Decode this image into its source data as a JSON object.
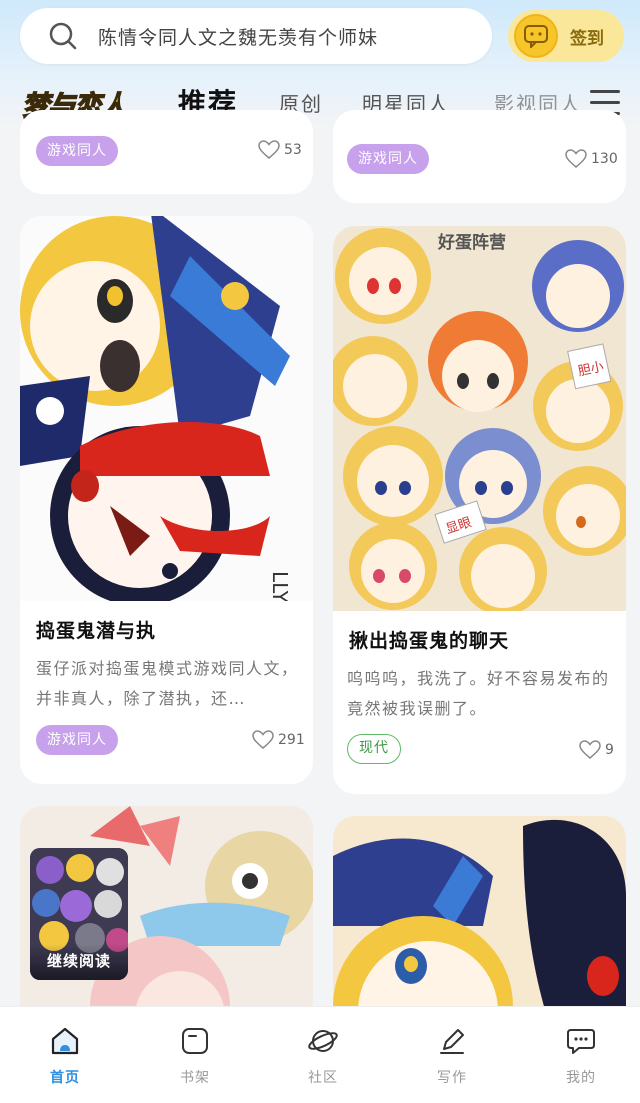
{
  "search": {
    "text": "陈情令同人文之魏无羡有个师妹"
  },
  "signin": {
    "label": "签到"
  },
  "header": {
    "logo": "梦与恋人",
    "tabs": [
      "推荐",
      "原创",
      "明星同人",
      "影视同人"
    ]
  },
  "cards": {
    "top_left": {
      "tag": "游戏同人",
      "likes": "53"
    },
    "top_right": {
      "tag": "游戏同人",
      "likes": "130"
    },
    "mid_left": {
      "title": "捣蛋鬼潜与执",
      "desc": "蛋仔派对捣蛋鬼模式游戏同人文，并非真人，除了潜执，还…",
      "tag": "游戏同人",
      "likes": "291",
      "image_text": "LLY"
    },
    "mid_right": {
      "title": "揪出捣蛋鬼的聊天",
      "desc": "呜呜呜，我洗了。好不容易发布的竟然被我误删了。",
      "tag": "现代",
      "likes": "9",
      "image_text_1": "好蛋阵营",
      "image_text_2": "胆小",
      "image_text_3": "显眼"
    }
  },
  "continue_reading": {
    "label": "继续阅读"
  },
  "bottom_nav": {
    "items": [
      "首页",
      "书架",
      "社区",
      "写作",
      "我的"
    ],
    "active": "首页"
  },
  "colors": {
    "accent": "#2f8fe0",
    "tag_purple": "#c7a1ec",
    "tag_green": "#5dbb63",
    "signin_bg": "#fbe79a"
  }
}
